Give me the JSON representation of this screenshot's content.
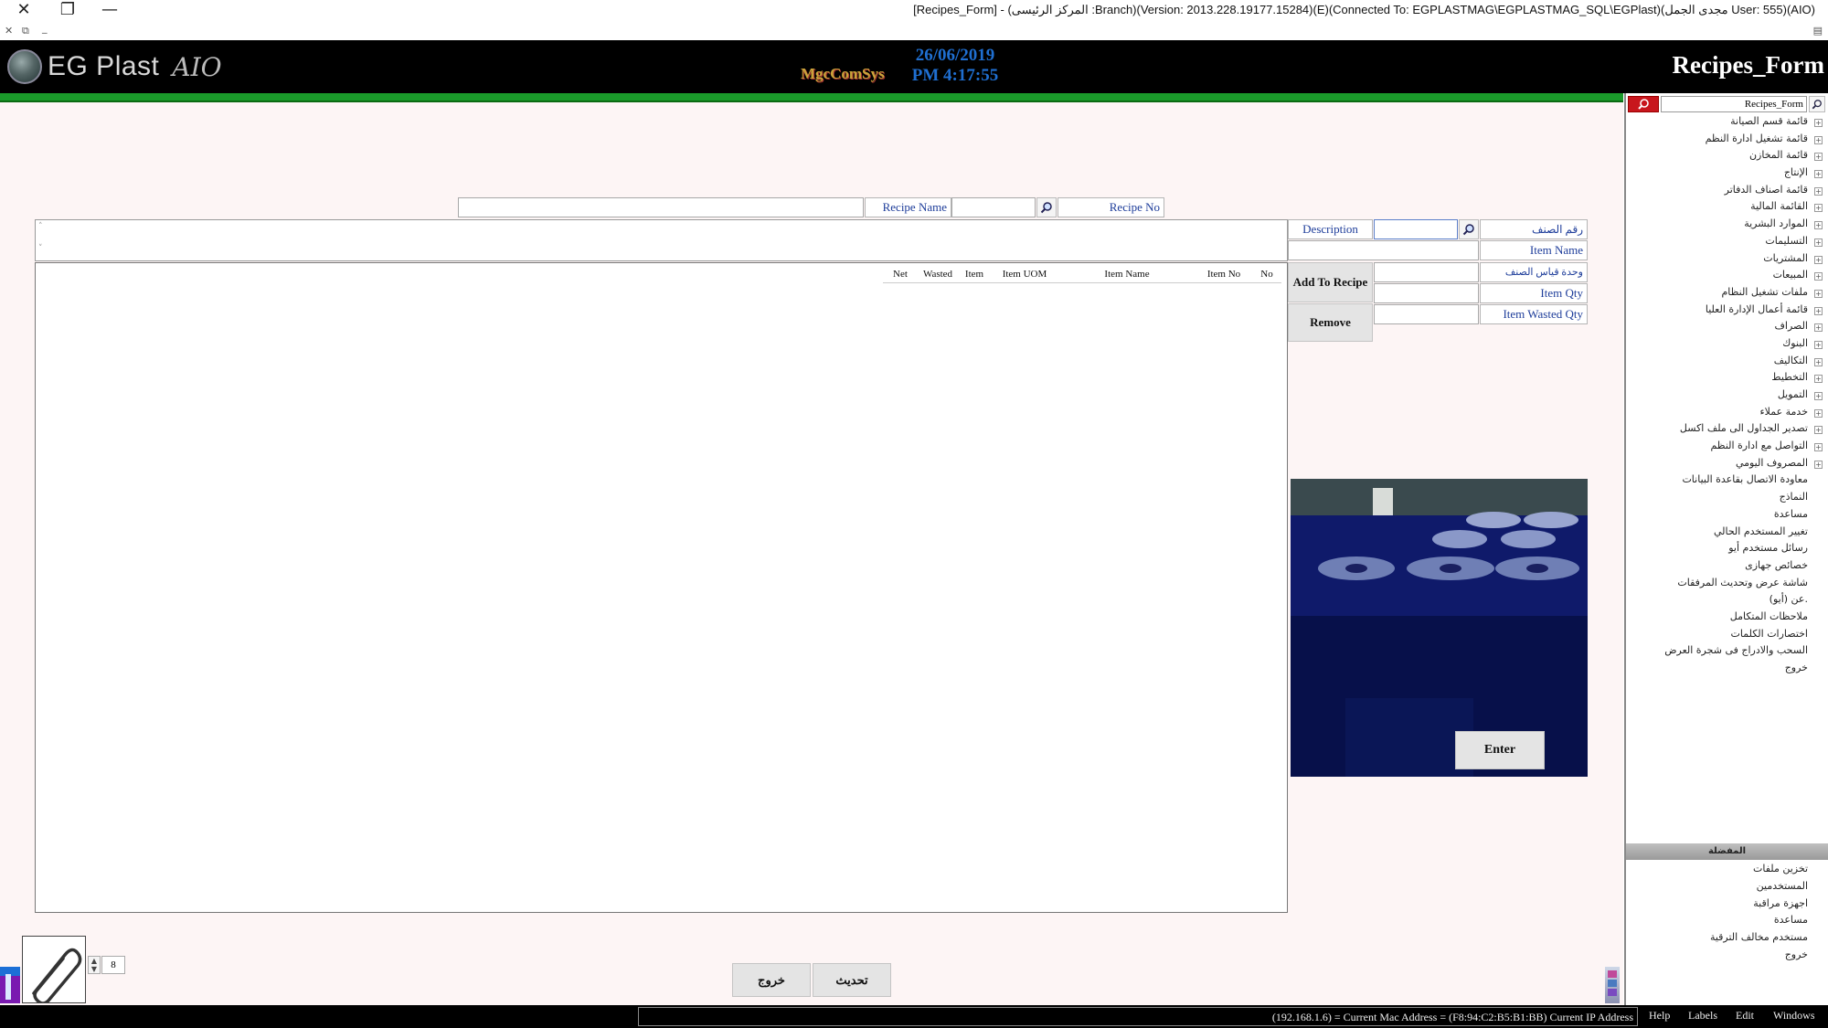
{
  "window": {
    "title": "[Recipes_Form] - (المركز الرئيسى :Branch)(Version: 2013.228.19177.15284)(E)(Connected To: EGPLASTMAG\\EGPLASTMAG_SQL\\EGPlast)(مجدى الجمل User: 555)(AIO)"
  },
  "header": {
    "logo_name": "EG Plast",
    "logo_suffix": "AIO",
    "brand": "MgcComSys",
    "date": "26/06/2019",
    "time": "PM 4:17:55",
    "form_title": "Recipes_Form"
  },
  "form": {
    "recipe_name_label": "Recipe Name",
    "recipe_no_label": "Recipe No",
    "description_label": "Description",
    "item_code_label": "رقم الصنف",
    "item_name_label": "Item Name",
    "item_uom_label": "وحدة قياس الصنف",
    "item_qty_label": "Item Qty",
    "item_wasted_label": "Item Wasted Qty",
    "add_button": "Add To Recipe",
    "remove_button": "Remove",
    "enter_button": "Enter",
    "exit_button": "خروج",
    "update_button": "تحديث",
    "attachments_count": "8"
  },
  "grid": {
    "columns": [
      "Net",
      "Wasted",
      "Item",
      "Item UOM",
      "Item Name",
      "Item No",
      "No"
    ]
  },
  "sidebar": {
    "search_value": "Recipes_Form",
    "tree": [
      {
        "label": "قائمة قسم الصيانة",
        "expand": true
      },
      {
        "label": "قائمة تشغيل ادارة النظم",
        "expand": true
      },
      {
        "label": "قائمة المخازن",
        "expand": true
      },
      {
        "label": "الإنتاج",
        "expand": true
      },
      {
        "label": "قائمة اصناف الدفاتر",
        "expand": true
      },
      {
        "label": "القائمة المالية",
        "expand": true
      },
      {
        "label": "الموارد البشرية",
        "expand": true
      },
      {
        "label": "التسليمات",
        "expand": true
      },
      {
        "label": "المشتريات",
        "expand": true
      },
      {
        "label": "المبيعات",
        "expand": true
      },
      {
        "label": "ملفات تشغيل النظام",
        "expand": true
      },
      {
        "label": "قائمة أعمال الإدارة العليا",
        "expand": true
      },
      {
        "label": "الصراف",
        "expand": true
      },
      {
        "label": "البنوك",
        "expand": true
      },
      {
        "label": "التكاليف",
        "expand": true
      },
      {
        "label": "التخطيط",
        "expand": true
      },
      {
        "label": "التمويل",
        "expand": true
      },
      {
        "label": "خدمة عملاء",
        "expand": true
      },
      {
        "label": "تصدير الجداول الى ملف اكسل",
        "expand": true
      },
      {
        "label": "التواصل مع ادارة النظم",
        "expand": true
      },
      {
        "label": "المصروف اليومي",
        "expand": true
      },
      {
        "label": "معاودة الاتصال بقاعدة البيانات",
        "expand": false
      },
      {
        "label": "النماذج",
        "expand": false
      },
      {
        "label": "مساعدة",
        "expand": false
      },
      {
        "label": "تغيير المستخدم الحالي",
        "expand": false
      },
      {
        "label": "رسائل مستخدم أيو",
        "expand": false
      },
      {
        "label": "خصائص جهازى",
        "expand": false
      },
      {
        "label": "شاشة عرض وتحديث المرفقات",
        "expand": false
      },
      {
        "label": "عن (أيو).",
        "expand": false
      },
      {
        "label": "ملاحظات المتكامل",
        "expand": false
      },
      {
        "label": "اختصارات الكلمات",
        "expand": false
      },
      {
        "label": "السحب والادراج فى شجرة العرض",
        "expand": false
      },
      {
        "label": "خروج",
        "expand": false
      }
    ],
    "favorites_title": "المفضلة",
    "favorites": [
      "تخزين ملفات",
      "المستخدمين",
      "اجهزة مراقبة",
      "مساعدة",
      "مستخدم مخالف الترقية",
      "خروج"
    ]
  },
  "statusbar": {
    "ip_text": "(192.168.1.6) = Current Mac Address = (F8:94:C2:B5:B1:BB) Current IP Address",
    "menu": [
      "Help",
      "Labels",
      "Edit",
      "Windows"
    ]
  },
  "colors": {
    "green_bar": "#1a9a2a",
    "label_text": "#1e3d9a",
    "date_text": "#1f6fd1"
  }
}
